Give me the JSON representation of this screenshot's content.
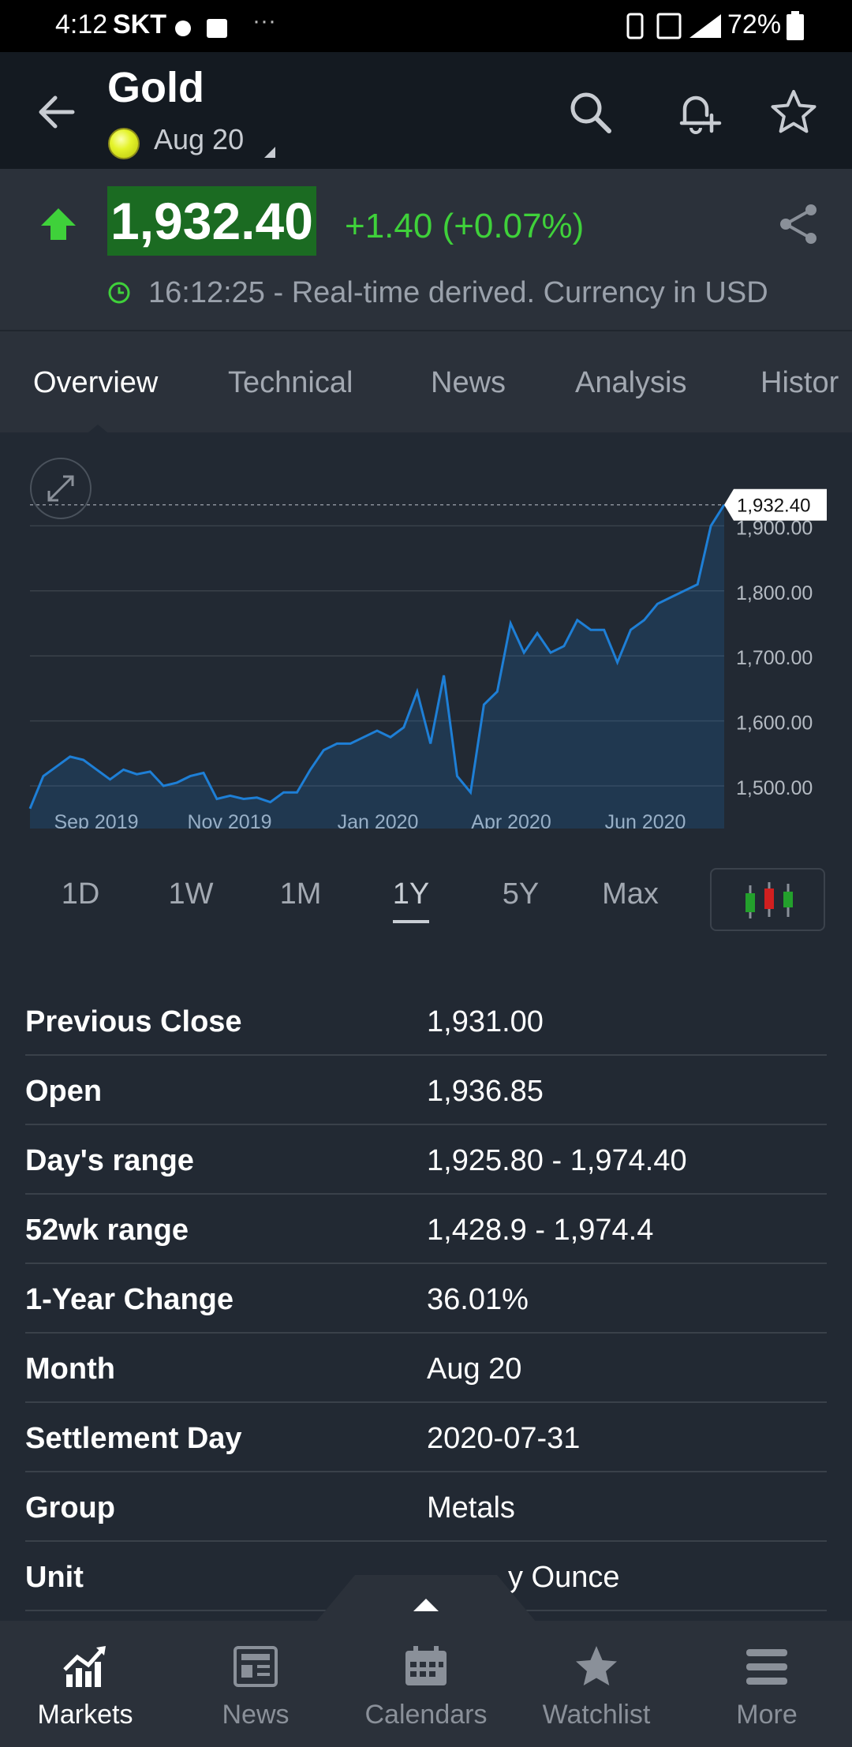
{
  "status_bar": {
    "time": "4:12",
    "carrier": "SKT",
    "dots": "···",
    "battery": "72%"
  },
  "header": {
    "title": "Gold",
    "contract": "Aug 20"
  },
  "quote": {
    "price": "1,932.40",
    "change": "+1.40 (+0.07%)",
    "time_note": "16:12:25 - Real-time derived. Currency in USD",
    "direction": "up",
    "up_color": "#3fd13a"
  },
  "tabs": [
    {
      "label": "Overview"
    },
    {
      "label": "Technical"
    },
    {
      "label": "News"
    },
    {
      "label": "Analysis"
    },
    {
      "label": "Histor"
    }
  ],
  "chart_data": {
    "type": "area",
    "y_axis_labels": [
      "1,900.00",
      "1,800.00",
      "1,700.00",
      "1,600.00",
      "1,500.00"
    ],
    "x_axis_labels": [
      "Sep 2019",
      "Nov 2019",
      "Jan 2020",
      "Apr 2020",
      "Jun 2020"
    ],
    "ylim": [
      1460,
      1960
    ],
    "last_value_label": "1,932.40",
    "last_value": 1932.4,
    "line_color": "#1e7fd6",
    "values": [
      1465,
      1515,
      1530,
      1545,
      1540,
      1525,
      1510,
      1525,
      1518,
      1522,
      1500,
      1505,
      1515,
      1520,
      1480,
      1485,
      1480,
      1482,
      1475,
      1490,
      1490,
      1525,
      1555,
      1565,
      1565,
      1575,
      1585,
      1575,
      1590,
      1645,
      1565,
      1670,
      1515,
      1490,
      1625,
      1645,
      1750,
      1705,
      1735,
      1705,
      1715,
      1755,
      1740,
      1740,
      1690,
      1740,
      1755,
      1780,
      1790,
      1800,
      1810,
      1900,
      1932.4
    ]
  },
  "ranges": [
    {
      "label": "1D"
    },
    {
      "label": "1W"
    },
    {
      "label": "1M"
    },
    {
      "label": "1Y",
      "active": true
    },
    {
      "label": "5Y"
    },
    {
      "label": "Max"
    }
  ],
  "stats": [
    {
      "label": "Previous Close",
      "value": "1,931.00"
    },
    {
      "label": "Open",
      "value": "1,936.85"
    },
    {
      "label": "Day's range",
      "value": "1,925.80 - 1,974.40"
    },
    {
      "label": "52wk range",
      "value": "1,428.9 - 1,974.4"
    },
    {
      "label": "1-Year Change",
      "value": "36.01%"
    },
    {
      "label": "Month",
      "value": "Aug 20"
    },
    {
      "label": "Settlement Day",
      "value": "2020-07-31"
    },
    {
      "label": "Group",
      "value": "Metals"
    },
    {
      "label": "Unit",
      "value": "y Ounce"
    }
  ],
  "bottom_nav": [
    {
      "label": "Markets",
      "icon": "markets-icon",
      "active": true
    },
    {
      "label": "News",
      "icon": "news-icon"
    },
    {
      "label": "Calendars",
      "icon": "calendar-icon"
    },
    {
      "label": "Watchlist",
      "icon": "star-icon"
    },
    {
      "label": "More",
      "icon": "menu-icon"
    }
  ]
}
